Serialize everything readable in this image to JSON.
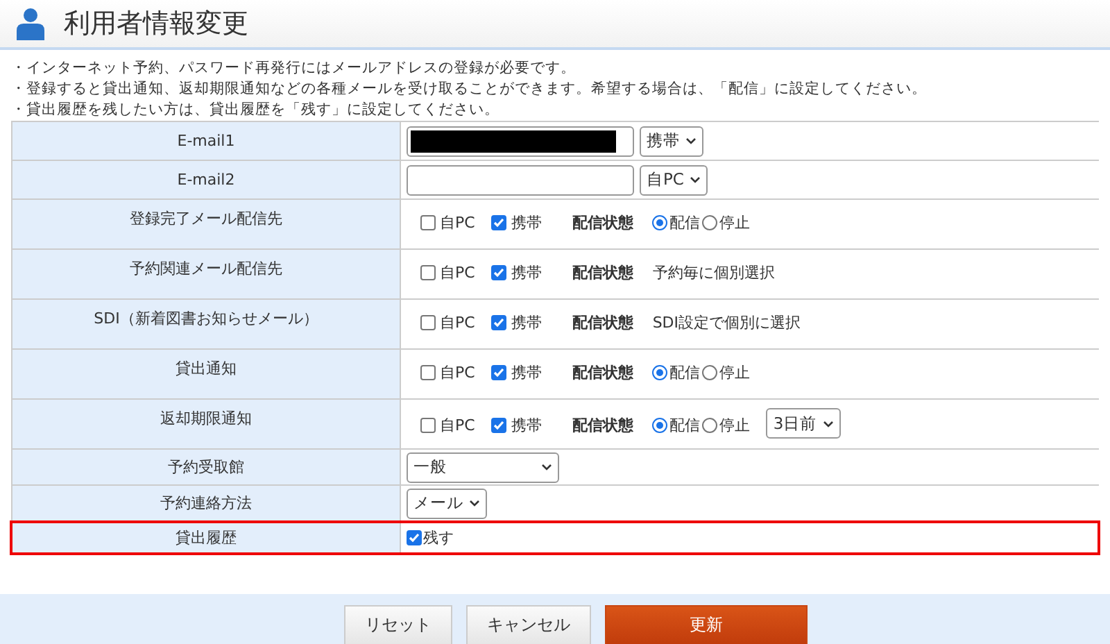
{
  "header": {
    "title": "利用者情報変更"
  },
  "notes": [
    "・インターネット予約、パスワード再発行にはメールアドレスの登録が必要です。",
    "・登録すると貸出通知、返却期限通知などの各種メールを受け取ることができます。希望する場合は、「配信」に設定してください。",
    "・貸出履歴を残したい方は、貸出履歴を「残す」に設定してください。"
  ],
  "rows": [
    {
      "kind": "email",
      "label": "E-mail1",
      "redacted": true,
      "select": "携帯",
      "highlighted": false
    },
    {
      "kind": "email",
      "label": "E-mail2",
      "redacted": false,
      "select": "自PC",
      "highlighted": false
    },
    {
      "kind": "delivery",
      "label": "登録完了メール配信先",
      "pc": {
        "label": "自PC",
        "checked": false
      },
      "mobile": {
        "label": "携帯",
        "checked": true
      },
      "status_label": "配信状態",
      "radios": [
        {
          "label": "配信",
          "selected": true
        },
        {
          "label": "停止",
          "selected": false
        }
      ],
      "highlighted": false
    },
    {
      "kind": "delivery",
      "label": "予約関連メール配信先",
      "pc": {
        "label": "自PC",
        "checked": false
      },
      "mobile": {
        "label": "携帯",
        "checked": true
      },
      "status_label": "配信状態",
      "status_text": "予約毎に個別選択",
      "highlighted": false
    },
    {
      "kind": "delivery",
      "label": "SDI（新着図書お知らせメール）",
      "pc": {
        "label": "自PC",
        "checked": false
      },
      "mobile": {
        "label": "携帯",
        "checked": true
      },
      "status_label": "配信状態",
      "status_text": "SDI設定で個別に選択",
      "highlighted": false
    },
    {
      "kind": "delivery",
      "label": "貸出通知",
      "pc": {
        "label": "自PC",
        "checked": false
      },
      "mobile": {
        "label": "携帯",
        "checked": true
      },
      "status_label": "配信状態",
      "radios": [
        {
          "label": "配信",
          "selected": true
        },
        {
          "label": "停止",
          "selected": false
        }
      ],
      "highlighted": false
    },
    {
      "kind": "delivery",
      "label": "返却期限通知",
      "pc": {
        "label": "自PC",
        "checked": false
      },
      "mobile": {
        "label": "携帯",
        "checked": true
      },
      "status_label": "配信状態",
      "radios": [
        {
          "label": "配信",
          "selected": true
        },
        {
          "label": "停止",
          "selected": false
        }
      ],
      "select": "3日前",
      "highlighted": false
    },
    {
      "kind": "select",
      "label": "予約受取館",
      "select": "一般",
      "wide": true,
      "highlighted": false
    },
    {
      "kind": "select",
      "label": "予約連絡方法",
      "select": "メール",
      "wide": false,
      "highlighted": false
    },
    {
      "kind": "checkbox",
      "label": "貸出履歴",
      "option": {
        "label": "残す",
        "checked": true
      },
      "highlighted": true
    }
  ],
  "buttons": [
    {
      "label": "リセット",
      "kind": "secondary"
    },
    {
      "label": "キャンセル",
      "kind": "secondary"
    },
    {
      "label": "更新",
      "kind": "primary"
    }
  ]
}
